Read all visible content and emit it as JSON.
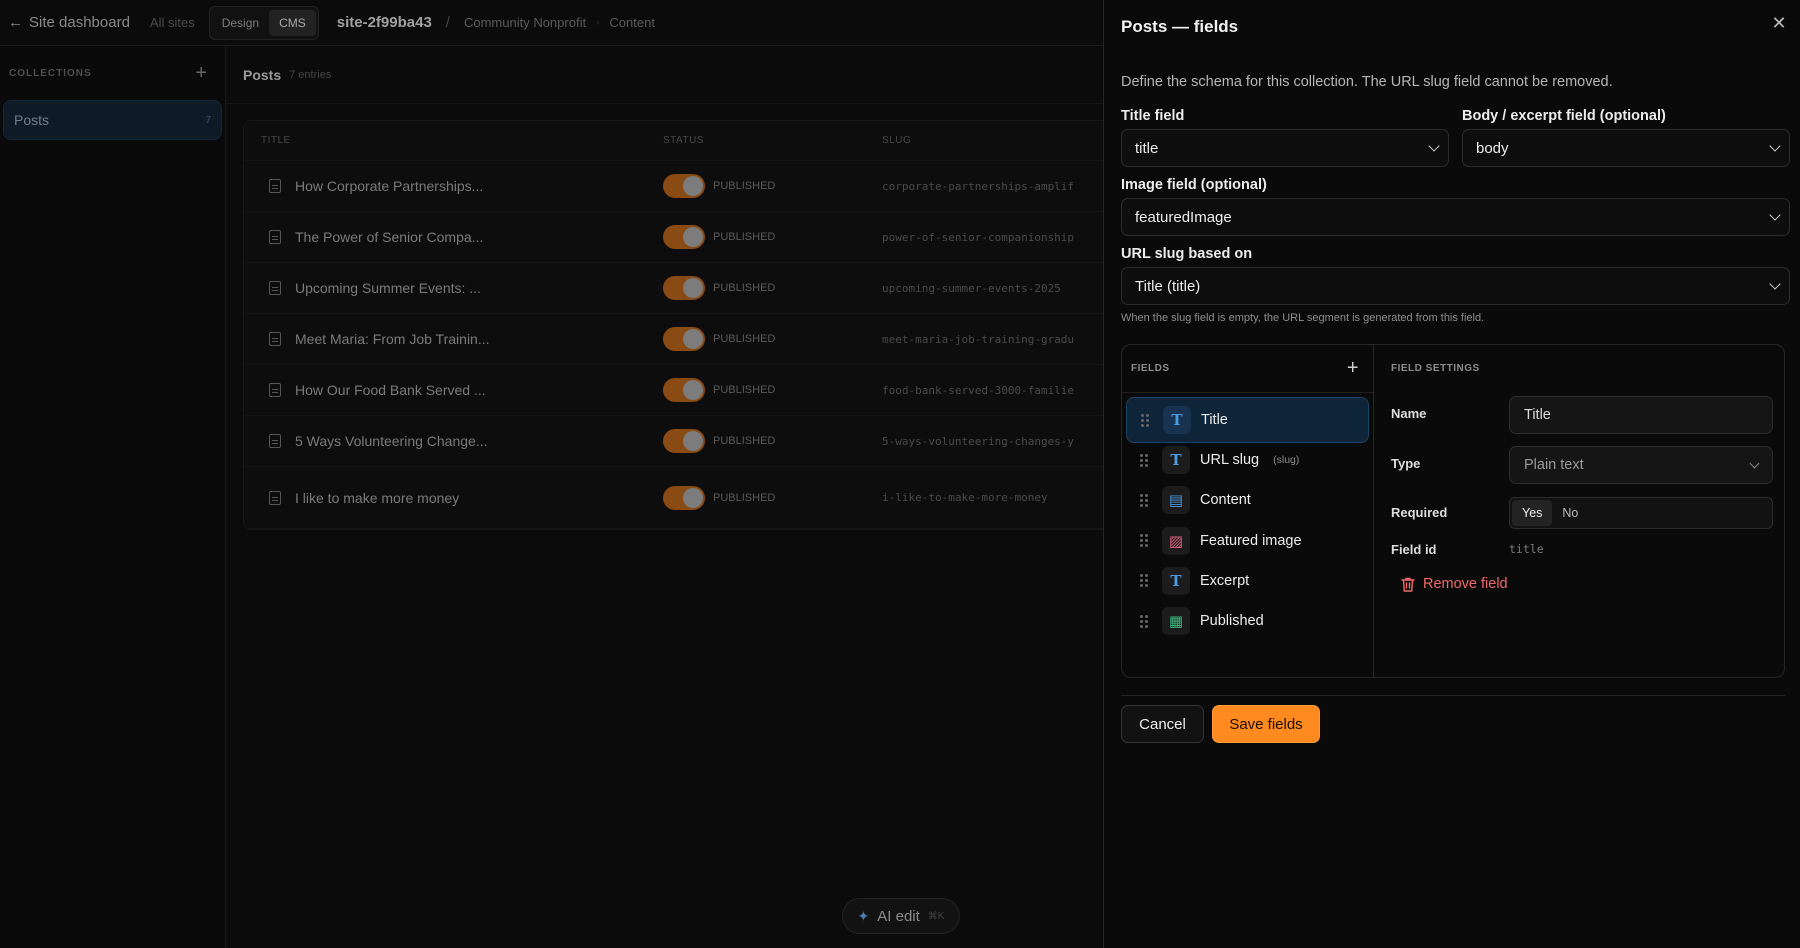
{
  "topbar": {
    "back_label": "Site dashboard",
    "all_sites": "All sites",
    "modes": [
      "Design",
      "CMS"
    ],
    "active_mode": "CMS",
    "site_id": "site-2f99ba43",
    "crumbs": [
      "Community Nonprofit",
      "Content"
    ]
  },
  "sidebar": {
    "heading": "COLLECTIONS",
    "items": [
      {
        "label": "Posts",
        "count": "7"
      }
    ]
  },
  "main": {
    "title": "Posts",
    "entries": "7 entries",
    "columns": [
      "TITLE",
      "STATUS",
      "SLUG"
    ],
    "rows": [
      {
        "title": "How Corporate Partnerships...",
        "status": "PUBLISHED",
        "slug": "corporate-partnerships-amplif"
      },
      {
        "title": "The Power of Senior Compa...",
        "status": "PUBLISHED",
        "slug": "power-of-senior-companionship"
      },
      {
        "title": "Upcoming Summer Events: ...",
        "status": "PUBLISHED",
        "slug": "upcoming-summer-events-2025"
      },
      {
        "title": "Meet Maria: From Job Trainin...",
        "status": "PUBLISHED",
        "slug": "meet-maria-job-training-gradu"
      },
      {
        "title": "How Our Food Bank Served ...",
        "status": "PUBLISHED",
        "slug": "food-bank-served-3000-familie"
      },
      {
        "title": "5 Ways Volunteering Change...",
        "status": "PUBLISHED",
        "slug": "5-ways-volunteering-changes-y"
      },
      {
        "title": "I like to make more money",
        "status": "PUBLISHED",
        "slug": "i-like-to-make-more-money"
      }
    ]
  },
  "ai_edit": {
    "label": "AI edit",
    "shortcut": "⌘K"
  },
  "panel": {
    "title": "Posts — fields",
    "description": "Define the schema for this collection. The URL slug field cannot be removed.",
    "title_field": {
      "label": "Title field",
      "value": "title"
    },
    "body_field": {
      "label": "Body / excerpt field (optional)",
      "value": "body"
    },
    "image_field": {
      "label": "Image field (optional)",
      "value": "featuredImage"
    },
    "slug_based": {
      "label": "URL slug based on",
      "value": "Title (title)"
    },
    "hint": "When the slug field is empty, the URL segment is generated from this field.",
    "fields_heading": "FIELDS",
    "fields": [
      {
        "label": "Title",
        "sub": "",
        "icon": "text-icon"
      },
      {
        "label": "URL slug",
        "sub": "(slug)",
        "icon": "text-icon"
      },
      {
        "label": "Content",
        "sub": "",
        "icon": "document-icon"
      },
      {
        "label": "Featured image",
        "sub": "",
        "icon": "image-icon"
      },
      {
        "label": "Excerpt",
        "sub": "",
        "icon": "text-icon"
      },
      {
        "label": "Published",
        "sub": "",
        "icon": "calendar-icon"
      }
    ],
    "settings": {
      "heading": "FIELD SETTINGS",
      "name_label": "Name",
      "name_value": "Title",
      "type_label": "Type",
      "type_value": "Plain text",
      "required_label": "Required",
      "required_options": [
        "Yes",
        "No"
      ],
      "required_selected": "Yes",
      "field_id_label": "Field id",
      "field_id_value": "title",
      "remove_label": "Remove field"
    },
    "cancel_label": "Cancel",
    "save_label": "Save fields"
  },
  "colors": {
    "accent": "#ff8a1f",
    "danger": "#f06a6a",
    "selected_bg": "#0e2438"
  }
}
